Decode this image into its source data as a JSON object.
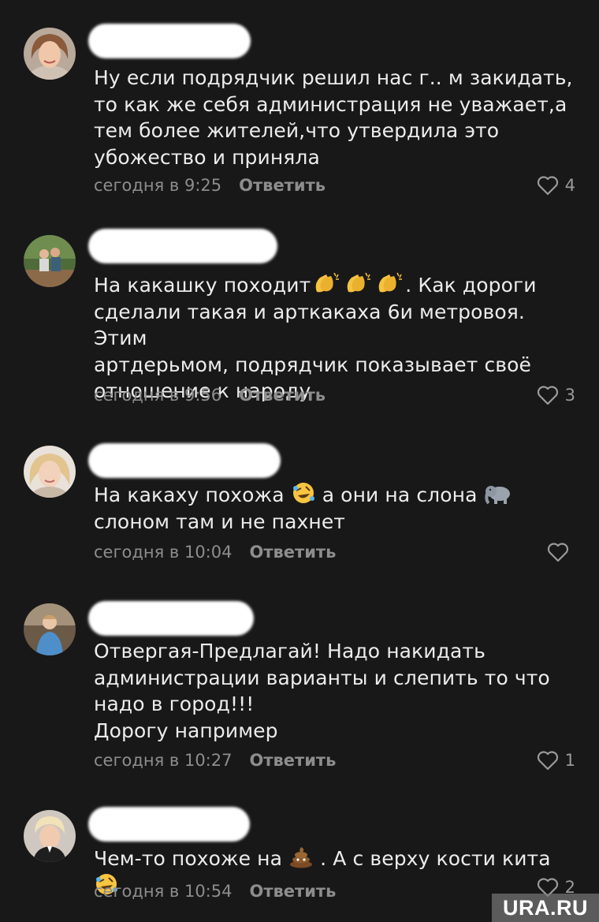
{
  "comments": [
    {
      "lines": [
        "Ну если подрядчик решил нас г.. м закидать,",
        "то как же себя администрация не уважает,а",
        "тем более жителей,что утвердила это",
        "убожество и приняла"
      ],
      "time": "сегодня в 9:25",
      "reply_label": "Ответить",
      "likes": "4"
    },
    {
      "line1_before": "На какашку походит",
      "line1_after": ". Как дороги",
      "emoji_1": [
        "clapping-hands-emoji",
        "clapping-hands-emoji",
        "clapping-hands-emoji"
      ],
      "rest_lines": [
        "сделали такая и арткакаха 6и метровоя. Этим",
        "артдерьмом, подрядчик показывает своё",
        "отношение к народу"
      ],
      "time": "сегодня в 9:56",
      "reply_label": "Ответить",
      "likes": "3"
    },
    {
      "line1_part1": "На какаху похожа",
      "line1_part2": "а они на слона",
      "emoji_a": "rolling-laughing-emoji",
      "emoji_b": "elephant-emoji",
      "line2": "слоном там и не пахнет",
      "time": "сегодня в 10:04",
      "reply_label": "Ответить",
      "likes": ""
    },
    {
      "lines": [
        "Отвергая-Предлагай! Надо накидать",
        "администрации варианты и слепить то что",
        "надо в город!!!",
        "Дорогу например"
      ],
      "time": "сегодня в 10:27",
      "reply_label": "Ответить",
      "likes": "1"
    },
    {
      "line1_part1": "Чем-то похоже на",
      "line1_part2": ". А с верху кости кита",
      "emoji_a": "poop-emoji",
      "emoji_b": "rolling-laughing-emoji",
      "time": "сегодня в 10:54",
      "reply_label": "Ответить",
      "likes": "2"
    }
  ],
  "watermark": "URA.RU",
  "colors": {
    "background": "#181818",
    "text": "#ececec",
    "meta": "#8d8d8d"
  }
}
